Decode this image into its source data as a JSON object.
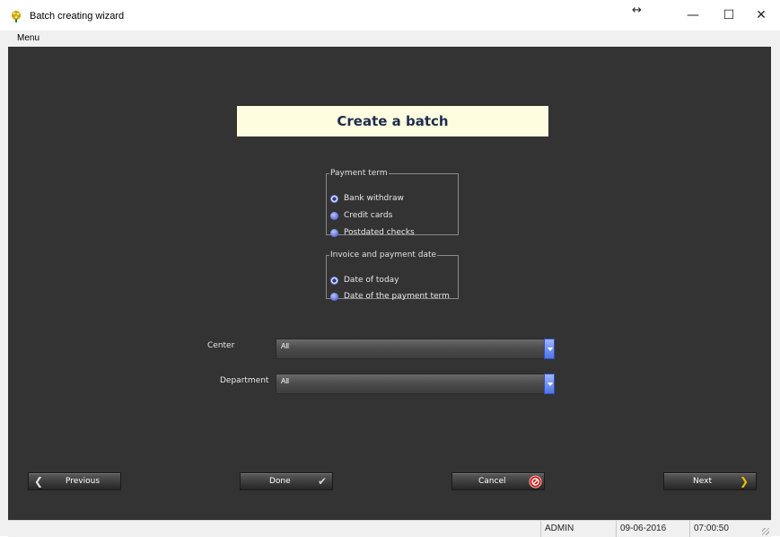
{
  "window": {
    "title": "Batch creating wizard",
    "resize_glyph": "↔",
    "minimize_glyph": "—",
    "maximize_glyph": "☐",
    "close_glyph": "✕"
  },
  "menubar": {
    "menu_label": "Menu"
  },
  "main": {
    "heading": "Create a batch",
    "payment_term": {
      "legend": "Payment term",
      "options": [
        {
          "label": "Bank withdraw",
          "selected": true
        },
        {
          "label": "Credit cards",
          "selected": false
        },
        {
          "label": "Postdated checks",
          "selected": false
        }
      ]
    },
    "invoice_date": {
      "legend": "Invoice and payment date",
      "options": [
        {
          "label": "Date of today",
          "selected": true
        },
        {
          "label": "Date of the payment term",
          "selected": false
        }
      ]
    },
    "center": {
      "label": "Center",
      "value": "All"
    },
    "department": {
      "label": "Department",
      "value": "All"
    }
  },
  "buttons": {
    "previous": "Previous",
    "done": "Done",
    "cancel": "Cancel",
    "next": "Next"
  },
  "statusbar": {
    "user": "ADMIN",
    "date": "09-06-2016",
    "time": "07:00:50"
  },
  "colors": {
    "background": "#333333",
    "banner": "#fefde0",
    "heading_text": "#1f2d4d",
    "radio_blue": "#6f7fe0",
    "combo_arrow": "#4e74e6"
  }
}
